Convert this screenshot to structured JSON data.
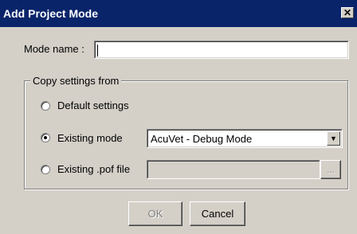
{
  "dialog": {
    "title": "Add Project Mode",
    "close_glyph": "✕"
  },
  "mode_name": {
    "label": "Mode name :",
    "value": ""
  },
  "copy_settings": {
    "legend": "Copy settings from",
    "options": [
      {
        "label": "Default settings",
        "selected": false
      },
      {
        "label": "Existing mode",
        "selected": true
      },
      {
        "label": "Existing .pof file",
        "selected": false
      }
    ],
    "existing_mode_value": "AcuVet - Debug Mode",
    "pof_file_value": "",
    "browse_label": "..."
  },
  "buttons": {
    "ok_label": "OK",
    "cancel_label": "Cancel"
  },
  "colors": {
    "title_bar": "#0a246a",
    "face": "#d4d0c8",
    "disabled_text": "#808080"
  },
  "icons": {
    "close": "close-icon",
    "dropdown": "chevron-down-icon"
  }
}
